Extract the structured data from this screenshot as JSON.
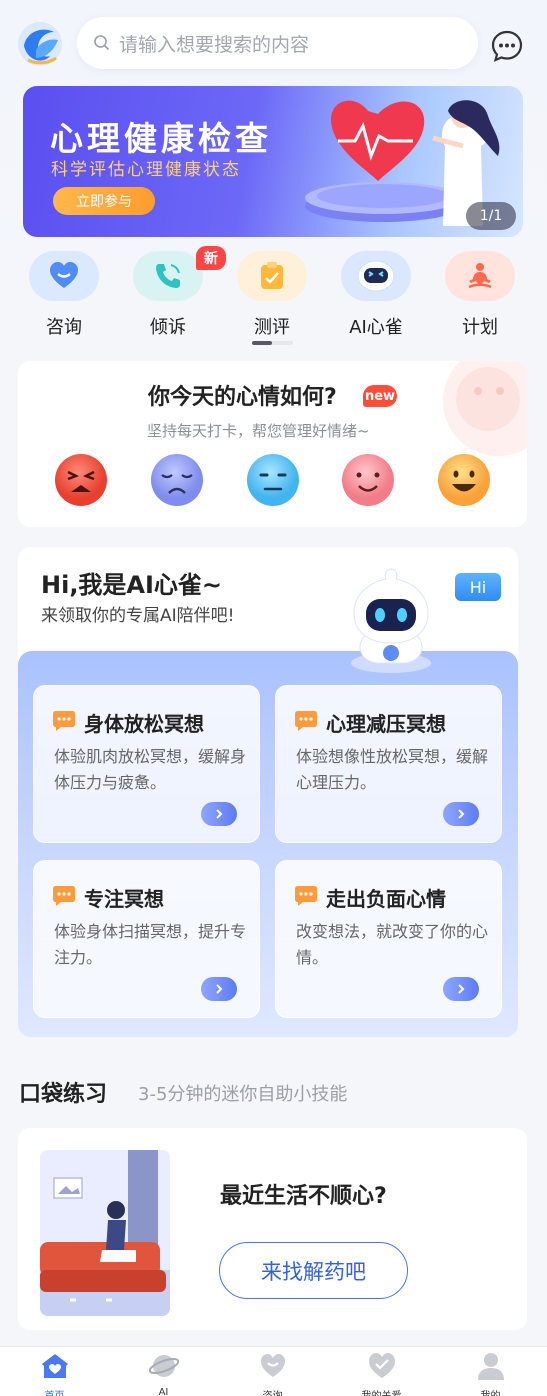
{
  "header": {
    "search_placeholder": "请输入想要搜索的内容"
  },
  "banner": {
    "title": "心理健康检查",
    "subtitle": "科学评估心理健康状态",
    "button": "立即参与",
    "pager": "1/1"
  },
  "quick_nav": {
    "items": [
      {
        "label": "咨询",
        "icon": "heart-chat-icon"
      },
      {
        "label": "倾诉",
        "icon": "phone-icon"
      },
      {
        "label": "测评",
        "icon": "clipboard-icon"
      },
      {
        "label": "AI心雀",
        "icon": "robot-icon"
      },
      {
        "label": "计划",
        "icon": "meditation-icon"
      }
    ],
    "badge": "新"
  },
  "mood": {
    "title": "你今天的心情如何?",
    "new_badge": "new",
    "subtitle": "坚持每天打卡，帮您管理好情绪~",
    "faces": [
      "angry-face-icon",
      "sad-face-icon",
      "neutral-face-icon",
      "smile-face-icon",
      "happy-face-icon"
    ]
  },
  "ai": {
    "title": "Hi,我是AI心雀~",
    "subtitle": "来领取你的专属AI陪伴吧!",
    "hi_badge": "Hi",
    "tiles": [
      {
        "title": "身体放松冥想",
        "desc": "体验肌肉放松冥想，缓解身体压力与疲惫。"
      },
      {
        "title": "心理减压冥想",
        "desc": "体验想像性放松冥想，缓解心理压力。"
      },
      {
        "title": "专注冥想",
        "desc": "体验身体扫描冥想，提升专注力。"
      },
      {
        "title": "走出负面心情",
        "desc": "改变想法，就改变了你的心情。"
      }
    ]
  },
  "pocket": {
    "title": "口袋练习",
    "subtitle": "3-5分钟的迷你自助小技能",
    "question": "最近生活不顺心?",
    "button": "来找解药吧"
  },
  "tabbar": {
    "items": [
      {
        "label": "首页",
        "active": true
      },
      {
        "label": "AI",
        "active": false
      },
      {
        "label": "咨询",
        "active": false
      },
      {
        "label": "我的关爱",
        "active": false
      },
      {
        "label": "我的",
        "active": false
      }
    ]
  },
  "colors": {
    "accent": "#3f6df0",
    "banner_start": "#5b4ff0",
    "badge_red": "#ff4545"
  }
}
